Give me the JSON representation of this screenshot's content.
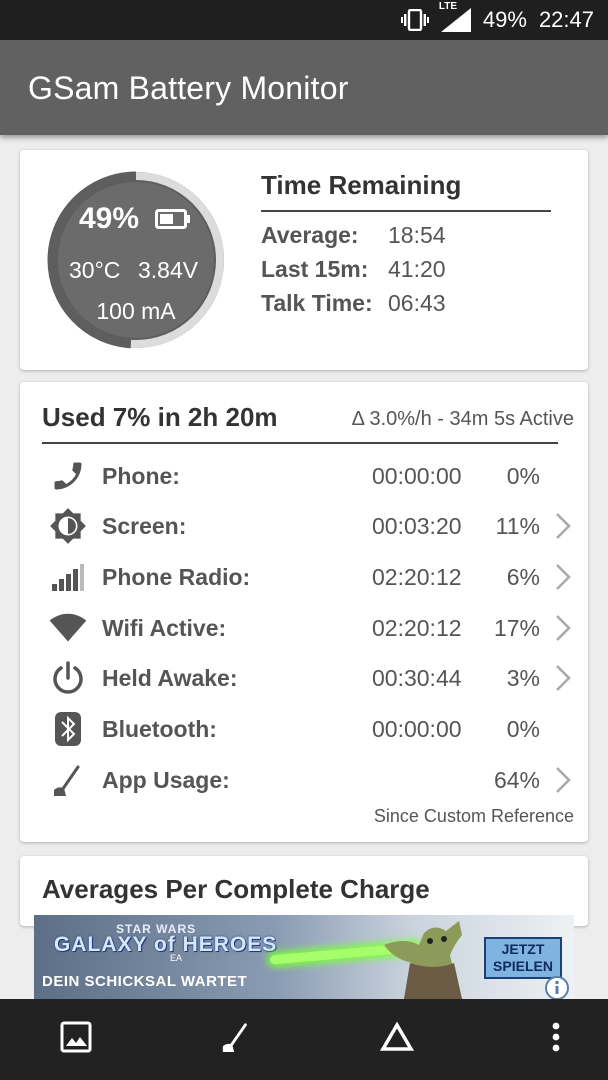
{
  "status_bar": {
    "battery_pct": "49%",
    "time": "22:47",
    "network_label": "LTE",
    "icons": [
      "vibrate-icon",
      "signal-icon"
    ]
  },
  "app_bar": {
    "title": "GSam Battery Monitor"
  },
  "battery_card": {
    "percent": "49%",
    "percent_fill": 0.49,
    "temperature": "30°C",
    "voltage": "3.84V",
    "current": "100 mA",
    "time_remaining": {
      "title": "Time Remaining",
      "rows": [
        {
          "label": "Average:",
          "value": "18:54"
        },
        {
          "label": "Last 15m:",
          "value": "41:20"
        },
        {
          "label": "Talk Time:",
          "value": "06:43"
        }
      ]
    }
  },
  "usage_card": {
    "title": "Used 7% in 2h 20m",
    "delta": "Δ 3.0%/h - 34m 5s Active",
    "rows": [
      {
        "icon": "phone-icon",
        "label": "Phone:",
        "time": "00:00:00",
        "pct": "0%",
        "has_chevron": false
      },
      {
        "icon": "screen-brightness-icon",
        "label": "Screen:",
        "time": "00:03:20",
        "pct": "11%",
        "has_chevron": true
      },
      {
        "icon": "signal-bars-icon",
        "label": "Phone Radio:",
        "time": "02:20:12",
        "pct": "6%",
        "has_chevron": true
      },
      {
        "icon": "wifi-icon",
        "label": "Wifi Active:",
        "time": "02:20:12",
        "pct": "17%",
        "has_chevron": true
      },
      {
        "icon": "power-icon",
        "label": "Held Awake:",
        "time": "00:30:44",
        "pct": "3%",
        "has_chevron": true
      },
      {
        "icon": "bluetooth-icon",
        "label": "Bluetooth:",
        "time": "00:00:00",
        "pct": "0%",
        "has_chevron": false
      },
      {
        "icon": "gauge-needle-icon",
        "label": "App Usage:",
        "time": "",
        "pct": "64%",
        "has_chevron": true
      }
    ],
    "footnote": "Since Custom Reference"
  },
  "averages_card": {
    "title": "Averages Per Complete Charge"
  },
  "ad": {
    "brand_top": "STAR WARS",
    "brand_main": "GALAXY of HEROES",
    "brand_ea": "EA",
    "tagline": "DEIN SCHICKSAL WARTET",
    "cta_line1": "JETZT",
    "cta_line2": "SPIELEN"
  },
  "bottom_nav": {
    "items": [
      "image-icon",
      "gauge-needle-icon",
      "delta-icon",
      "overflow-menu-icon"
    ]
  },
  "colors": {
    "status_bar": "#1f1f1f",
    "app_bar": "#616161",
    "gauge_fill": "#6b6b6b",
    "gauge_ring": "#dcdcdc",
    "bottom_nav": "#222222"
  }
}
